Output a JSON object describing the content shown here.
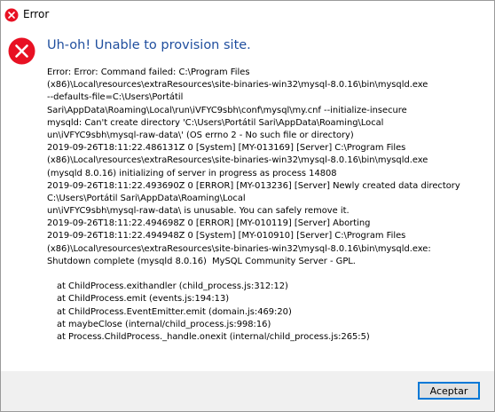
{
  "window": {
    "title": "Error",
    "error_color": "#e81123",
    "heading_color": "#1f4e9e"
  },
  "dialog": {
    "icon": "error-x-icon",
    "heading": "Uh-oh! Unable to provision site.",
    "message_lines": [
      "Error: Error: Command failed: C:\\Program Files",
      "(x86)\\Local\\resources\\extraResources\\site-binaries-win32\\mysql-8.0.16\\bin\\mysqld.exe",
      "--defaults-file=C:\\Users\\Portátil",
      "Sari\\AppData\\Roaming\\Local\\run\\iVFYC9sbh\\conf\\mysql\\my.cnf --initialize-insecure",
      "mysqld: Can't create directory 'C:\\Users\\Portátil Sari\\AppData\\Roaming\\Local",
      "un\\iVFYC9sbh\\mysql-raw-data\\' (OS errno 2 - No such file or directory)",
      "2019-09-26T18:11:22.486131Z 0 [System] [MY-013169] [Server] C:\\Program Files",
      "(x86)\\Local\\resources\\extraResources\\site-binaries-win32\\mysql-8.0.16\\bin\\mysqld.exe",
      "(mysqld 8.0.16) initializing of server in progress as process 14808",
      "2019-09-26T18:11:22.493690Z 0 [ERROR] [MY-013236] [Server] Newly created data directory",
      "C:\\Users\\Portátil Sari\\AppData\\Roaming\\Local",
      "un\\iVFYC9sbh\\mysql-raw-data\\ is unusable. You can safely remove it.",
      "2019-09-26T18:11:22.494698Z 0 [ERROR] [MY-010119] [Server] Aborting",
      "2019-09-26T18:11:22.494948Z 0 [System] [MY-010910] [Server] C:\\Program Files",
      "(x86)\\Local\\resources\\extraResources\\site-binaries-win32\\mysql-8.0.16\\bin\\mysqld.exe:",
      "Shutdown complete (mysqld 8.0.16)  MySQL Community Server - GPL."
    ],
    "stack_lines": [
      "at ChildProcess.exithandler (child_process.js:312:12)",
      "at ChildProcess.emit (events.js:194:13)",
      "at ChildProcess.EventEmitter.emit (domain.js:469:20)",
      "at maybeClose (internal/child_process.js:998:16)",
      "at Process.ChildProcess._handle.onexit (internal/child_process.js:265:5)"
    ]
  },
  "footer": {
    "accept_label": "Aceptar"
  }
}
